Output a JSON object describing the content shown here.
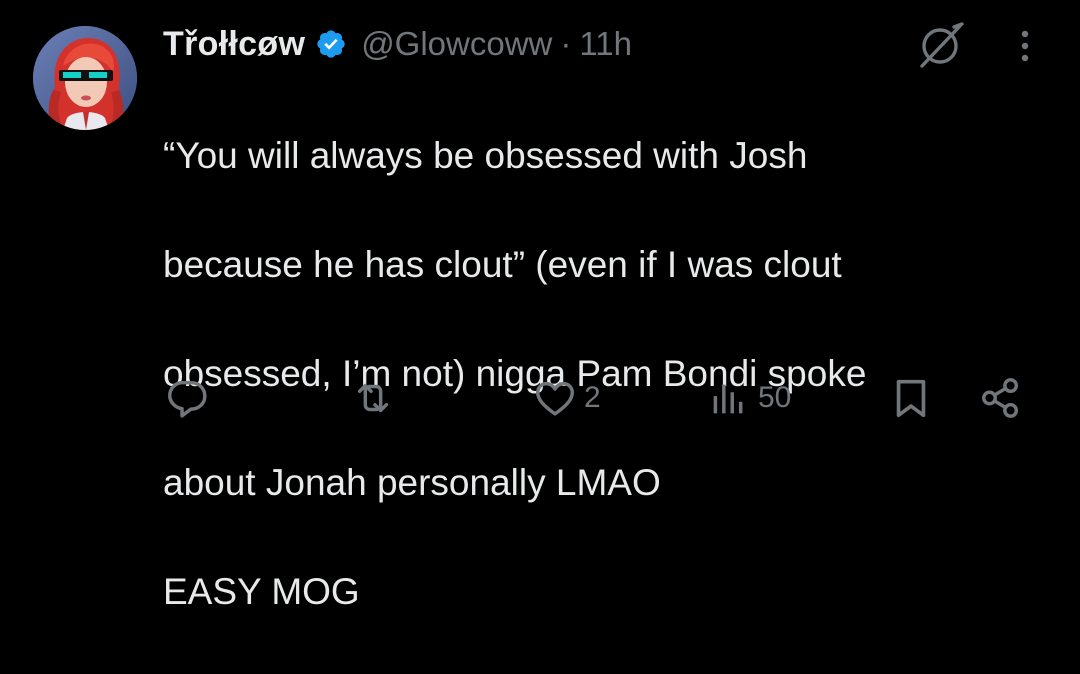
{
  "tweet": {
    "author": {
      "display_name": "Třołłcøw",
      "handle": "@Glowcoww",
      "verified": true
    },
    "separator": "·",
    "time": "11h",
    "lines": [
      "“You will always be obsessed with Josh",
      "because he has clout” (even if I was clout",
      "obsessed, I’m not) nigga Pam Bondi spoke",
      "about Jonah personally LMAO",
      "EASY MOG"
    ],
    "actions": {
      "reply": {
        "icon": "reply-icon",
        "count": ""
      },
      "repost": {
        "icon": "repost-icon",
        "count": ""
      },
      "like": {
        "icon": "heart-icon",
        "count": "2"
      },
      "views": {
        "icon": "analytics-icon",
        "count": "50"
      },
      "bookmark": {
        "icon": "bookmark-icon",
        "count": ""
      },
      "share": {
        "icon": "share-icon",
        "count": ""
      }
    }
  },
  "colors": {
    "background": "#000000",
    "text_primary": "#e7e9ea",
    "text_secondary": "#71767b",
    "verified_blue": "#1d9bf0"
  }
}
